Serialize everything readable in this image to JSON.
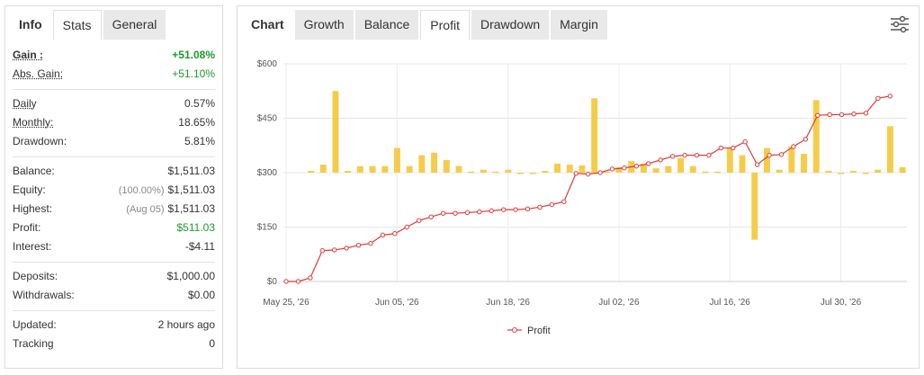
{
  "left": {
    "tabs": [
      "Info",
      "Stats",
      "General"
    ],
    "rows_group1": [
      {
        "label": "Gain :",
        "value": "+51.08%"
      },
      {
        "label": "Abs. Gain:",
        "value": "+51.10%"
      }
    ],
    "rows_group2": [
      {
        "label": "Daily",
        "value": "0.57%"
      },
      {
        "label": "Monthly:",
        "value": "18.65%"
      },
      {
        "label": "Drawdown:",
        "value": "5.81%"
      }
    ],
    "rows_group3": [
      {
        "label": "Balance:",
        "value": "$1,511.03",
        "note": ""
      },
      {
        "label": "Equity:",
        "value": "$1,511.03",
        "note": "(100.00%)"
      },
      {
        "label": "Highest:",
        "value": "$1,511.03",
        "note": "(Aug 05)"
      },
      {
        "label": "Profit:",
        "value": "$511.03",
        "note": ""
      },
      {
        "label": "Interest:",
        "value": "-$4.11",
        "note": ""
      }
    ],
    "rows_group4": [
      {
        "label": "Deposits:",
        "value": "$1,000.00"
      },
      {
        "label": "Withdrawals:",
        "value": "$0.00"
      }
    ],
    "rows_group5": [
      {
        "label": "Updated:",
        "value": "2 hours ago"
      },
      {
        "label": "Tracking",
        "value": "0"
      }
    ]
  },
  "right": {
    "tabs": [
      "Chart",
      "Growth",
      "Balance",
      "Profit",
      "Drawdown",
      "Margin"
    ],
    "active_tab": "Profit"
  },
  "colors": {
    "line": "#e03b3b",
    "bar": "#f5cc4a",
    "green": "#1c9c2a"
  },
  "chart_data": {
    "type": "bar+line",
    "y_ticks": [
      "$600",
      "$450",
      "$300",
      "$150",
      "$0"
    ],
    "ylim": [
      0,
      600
    ],
    "x_tick_labels": [
      "May 25, '26",
      "Jun 05, '26",
      "Jun 18, '26",
      "Jul 02, '26",
      "Jul 16, '26",
      "Jul 30, '26"
    ],
    "legend": "Profit",
    "grid": true,
    "bar_baseline": 300,
    "days": 50,
    "line_values": [
      0,
      0,
      10,
      85,
      87,
      92,
      100,
      105,
      128,
      132,
      150,
      168,
      178,
      188,
      188,
      190,
      192,
      195,
      198,
      198,
      200,
      205,
      212,
      220,
      298,
      296,
      300,
      310,
      313,
      318,
      325,
      335,
      345,
      348,
      348,
      348,
      368,
      368,
      385,
      322,
      348,
      350,
      372,
      392,
      458,
      460,
      460,
      462,
      464,
      505,
      511
    ],
    "bar_values": [
      null,
      305,
      322,
      525,
      305,
      318,
      318,
      318,
      368,
      318,
      348,
      355,
      335,
      318,
      303,
      308,
      303,
      308,
      300,
      300,
      305,
      325,
      322,
      320,
      505,
      303,
      315,
      332,
      325,
      312,
      318,
      340,
      318,
      303,
      303,
      368,
      348,
      115,
      368,
      308,
      372,
      352,
      500,
      305,
      300,
      305,
      300,
      308,
      428,
      315
    ]
  }
}
